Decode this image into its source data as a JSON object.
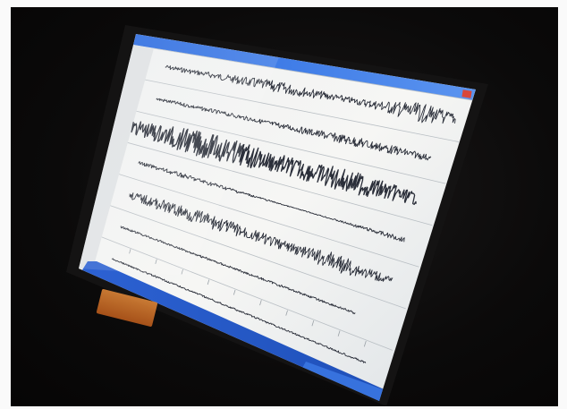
{
  "window": {
    "title": "",
    "titlebar_color": "#1f5fd6",
    "screen_color": "#e9ecef"
  },
  "taskbar": {
    "color": "#2456c9",
    "tray_text": ""
  },
  "traces": {
    "count": 7,
    "color": "#2b2f3a"
  }
}
